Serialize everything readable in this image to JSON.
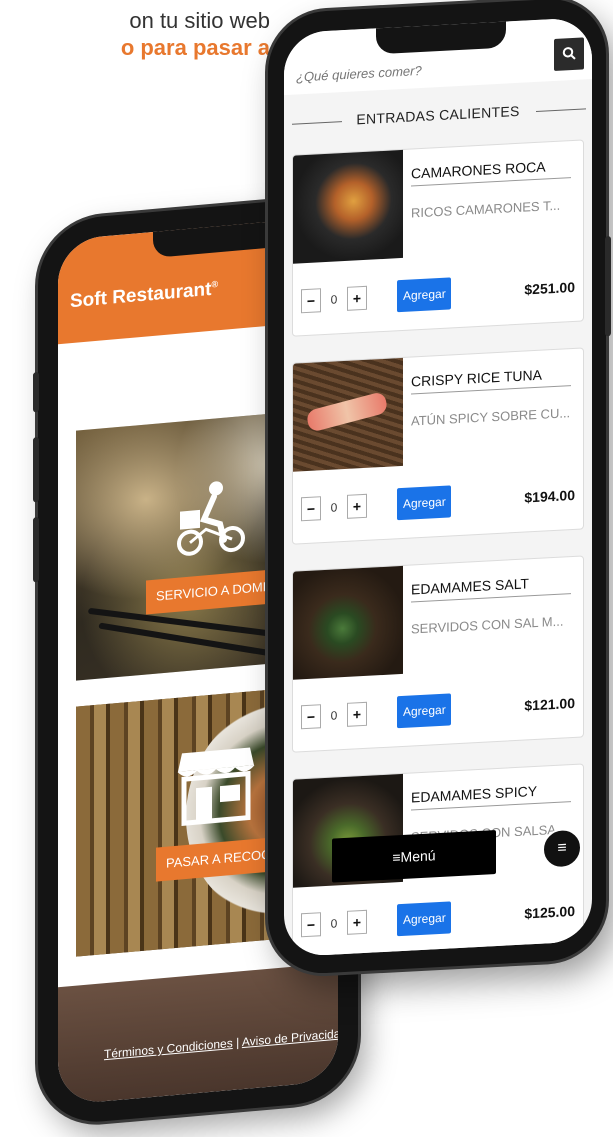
{
  "promo": {
    "line1": "on tu sitio web",
    "line2": "o para pasar a"
  },
  "left_app": {
    "logo": "Soft Restaurant",
    "logo_mark": "®",
    "tiles": [
      {
        "button_label": "SERVICIO A DOMICILIO",
        "icon": "delivery-bike-icon"
      },
      {
        "button_label": "PASAR A RECOGER",
        "icon": "storefront-icon"
      }
    ],
    "footer": {
      "terms": "Términos y Condiciones",
      "separator": "|",
      "privacy": "Aviso de Privacidad"
    }
  },
  "right_app": {
    "search": {
      "placeholder": "¿Qué quieres comer?",
      "icon": "search-icon"
    },
    "section_title": "ENTRADAS CALIENTES",
    "items": [
      {
        "name": "CAMARONES ROCA",
        "description": "RICOS CAMARONES T...",
        "quantity": "0",
        "add_label": "Agregar",
        "price": "$251.00"
      },
      {
        "name": "CRISPY RICE TUNA",
        "description": "ATÚN SPICY SOBRE CU...",
        "quantity": "0",
        "add_label": "Agregar",
        "price": "$194.00"
      },
      {
        "name": "EDAMAMES SALT",
        "description": "SERVIDOS CON SAL M...",
        "quantity": "0",
        "add_label": "Agregar",
        "price": "$121.00"
      },
      {
        "name": "EDAMAMES SPICY",
        "description": "SERVIDOS CON SALSA...",
        "quantity": "0",
        "add_label": "Agregar",
        "price": "$125.00"
      }
    ],
    "stepper": {
      "minus": "−",
      "plus": "+"
    },
    "menu_button": "≡Menú",
    "fab_icon": "hamburger-icon",
    "fab_glyph": "≡"
  },
  "colors": {
    "brand_orange": "#e8782e",
    "add_button_blue": "#1a73e8",
    "footer_brown": "#5a4236"
  }
}
